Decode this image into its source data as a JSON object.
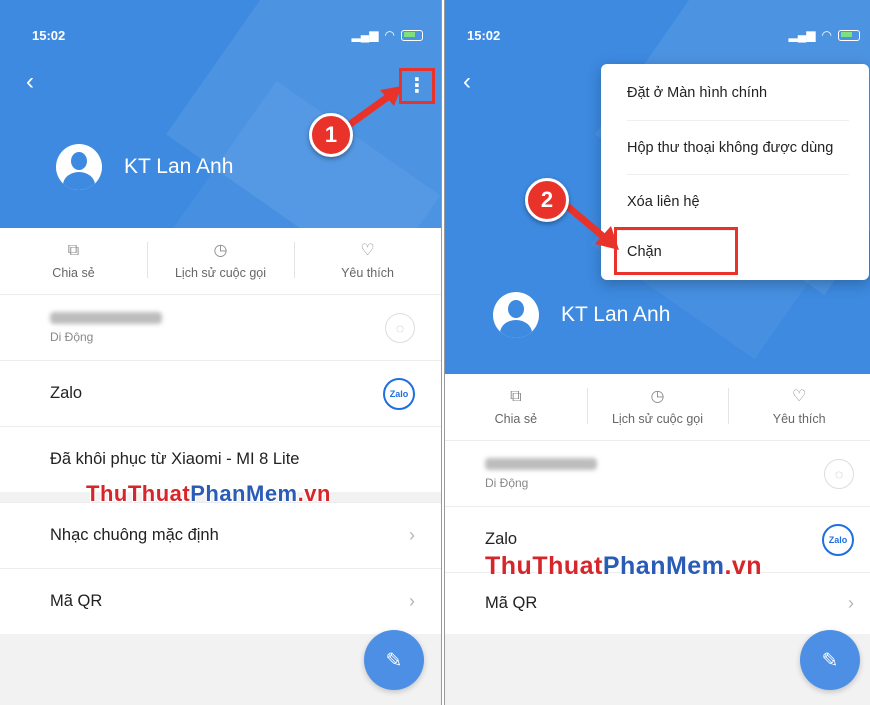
{
  "left": {
    "status_time": "15:02",
    "contact_name": "KT Lan Anh",
    "actions": [
      "Chia sẻ",
      "Lịch sử cuộc gọi",
      "Yêu thích"
    ],
    "phone_label": "Di Động",
    "rows": {
      "zalo": "Zalo",
      "restored": "Đã khôi phục từ Xiaomi - MI 8 Lite",
      "ringtone": "Nhạc chuông mặc định",
      "qr": "Mã QR"
    },
    "step_badge": "1"
  },
  "right": {
    "status_time": "15:02",
    "contact_name": "KT Lan Anh",
    "actions": [
      "Chia sẻ",
      "Lịch sử cuộc gọi",
      "Yêu thích"
    ],
    "phone_label": "Di Động",
    "rows": {
      "zalo": "Zalo",
      "qr": "Mã QR"
    },
    "menu": [
      "Đặt ở Màn hình chính",
      "Hộp thư thoại không được dùng",
      "Xóa liên hệ",
      "Chặn"
    ],
    "step_badge": "2"
  },
  "icons": {
    "zalo_text": "Zalo"
  },
  "watermark": {
    "part1": "ThuThuat",
    "part2": "PhanMem",
    "part3": ".vn"
  },
  "colors": {
    "header_blue": "#3d8ae0",
    "annotation_red": "#e8322a",
    "fab_blue": "#4e8fe6"
  }
}
